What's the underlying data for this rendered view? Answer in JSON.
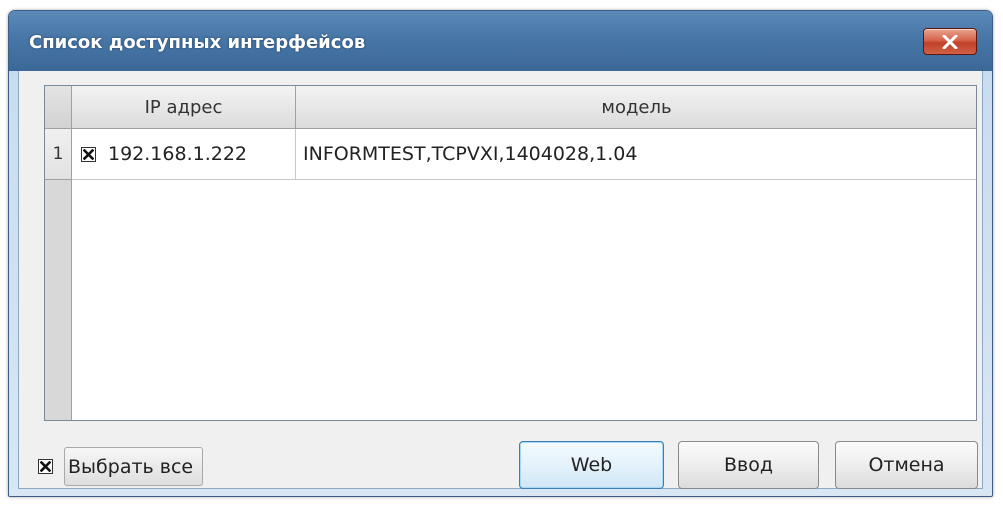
{
  "window": {
    "title": "Список доступных интерфейсов"
  },
  "table": {
    "columns": [
      "IP адрес",
      "модель"
    ],
    "rows": [
      {
        "number": "1",
        "checked": true,
        "ip": "192.168.1.222",
        "model": "INFORMTEST,TCPVXI,1404028,1.04"
      }
    ]
  },
  "footer": {
    "select_all_checked": true,
    "select_all_label": "Выбрать все",
    "buttons": {
      "web": "Web",
      "enter": "Ввод",
      "cancel": "Отмена"
    }
  },
  "colors": {
    "titlebar": "#4876a6",
    "close_button": "#c7472f",
    "default_button_border": "#3c7fb1"
  },
  "icons": {
    "close": "close-icon",
    "checkbox": "checkbox-checked-icon"
  }
}
